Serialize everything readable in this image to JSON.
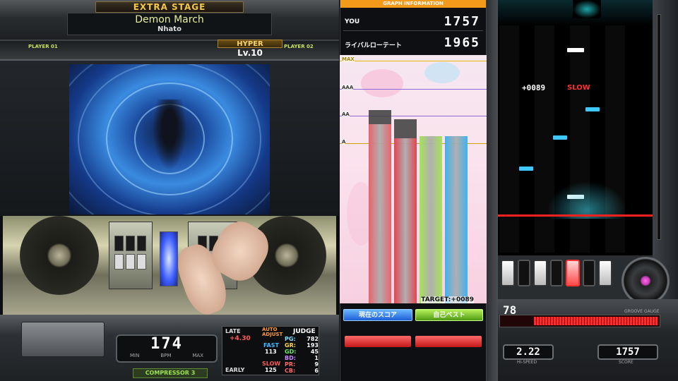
{
  "header": {
    "stage": "EXTRA STAGE",
    "title": "Demon March",
    "artist": "Nhato",
    "player1": "PLAYER 01",
    "player2": "PLAYER 02",
    "difficulty": "HYPER",
    "level": "Lv.10"
  },
  "bpm": {
    "value": "174",
    "label": "BPM",
    "min_label": "MIN",
    "max_label": "MAX"
  },
  "option": "COMPRESSOR 3",
  "judge": {
    "late_label": "LATE",
    "auto_adjust": "AUTO ADJUST",
    "judge_label": "JUDGE",
    "offset": "+4.30",
    "fast_label": "FAST",
    "fast_value": "113",
    "slow_label": "SLOW",
    "slow_value": "125",
    "early_label": "EARLY",
    "rows": [
      {
        "label": "PG:",
        "value": "782"
      },
      {
        "label": "GR:",
        "value": "193"
      },
      {
        "label": "GD:",
        "value": "45"
      },
      {
        "label": "BD:",
        "value": "1"
      },
      {
        "label": "PR:",
        "value": "9"
      },
      {
        "label": "CB:",
        "value": "6"
      }
    ]
  },
  "graph": {
    "header": "GRAPH INFORMATION",
    "you_label": "YOU",
    "you_score": "1757",
    "rival_label": "ライバルローテート",
    "rival_score": "1965",
    "lines": [
      "MAX",
      "AAA",
      "AA",
      "A"
    ],
    "target": "TARGET:+0089",
    "btn_current": "現在のスコア",
    "btn_best": "自己ベスト",
    "bar_colors": [
      "#e8646c",
      "#e14552",
      "#a6e35a",
      "#3fb2f0"
    ],
    "bars": [
      {
        "fill": 0.76,
        "ghost": 0.82
      },
      {
        "fill": 0.7,
        "ghost": 0.78
      },
      {
        "fill": 0.71,
        "ghost": 0.71
      },
      {
        "fill": 0.71,
        "ghost": 0.71
      }
    ]
  },
  "play": {
    "timing": "+0089",
    "timing_label": "SLOW",
    "hi_speed": "2.22",
    "hi_speed_label": "HI-SPEED",
    "score": "1757",
    "score_label": "SCORE",
    "gauge": "78",
    "gauge_fill": 0.78,
    "gauge_label": "GROOVE GAUGE"
  },
  "colors": {
    "judge_line": "#ff2020",
    "note_blue": "#3ec8ff",
    "note_white": "#ffffff",
    "gauge_red": "#ff2a2a"
  }
}
